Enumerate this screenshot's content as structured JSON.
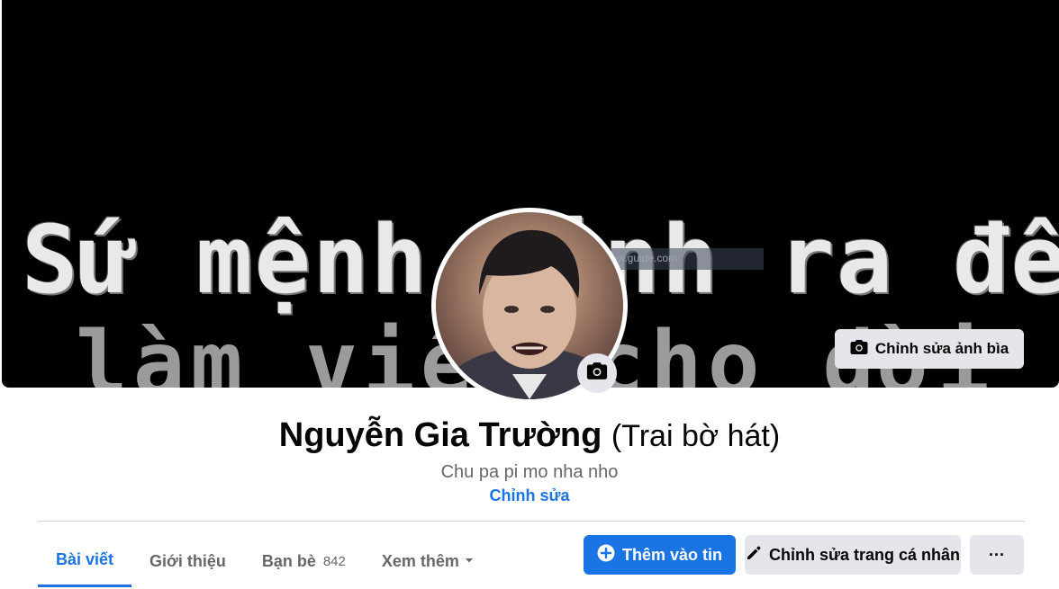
{
  "cover": {
    "line1": "Sứ mệnh sinh ra để",
    "line2": "làm việc cho đời",
    "ghost_label": "www.guide.com",
    "edit_cover_label": "Chỉnh sửa ảnh bìa",
    "icon": "camera-icon"
  },
  "profile": {
    "name": "Nguyễn Gia Trường",
    "alt_name": "(Trai bờ hát)",
    "bio": "Chu pa pi mo nha nho",
    "edit_bio_label": "Chỉnh sửa",
    "avatar_icon": "camera-icon"
  },
  "tabs": [
    {
      "label": "Bài viết",
      "active": true
    },
    {
      "label": "Giới thiệu",
      "active": false
    },
    {
      "label": "Bạn bè",
      "count": "842",
      "active": false
    },
    {
      "label": "Xem thêm",
      "active": false,
      "icon": "caret-down-icon"
    }
  ],
  "actions": {
    "add_story_label": "Thêm vào tin",
    "edit_profile_label": "Chỉnh sửa trang cá nhân",
    "more_label": "···"
  },
  "colors": {
    "accent": "#1b74e4",
    "secondary_bg": "#e4e6eb",
    "text_muted": "#65676b"
  }
}
